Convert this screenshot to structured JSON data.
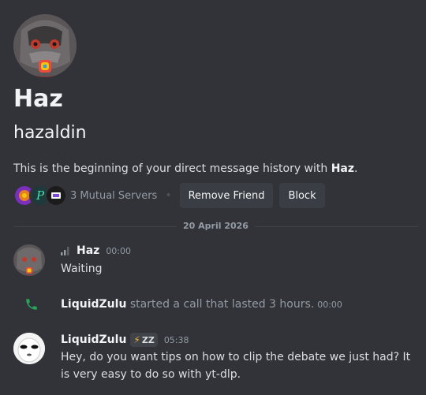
{
  "profile": {
    "display_name": "Haz",
    "username": "hazaldin",
    "intro_prefix": "This is the beginning of your direct message history with ",
    "intro_name": "Haz",
    "intro_suffix": ".",
    "mutual_servers": "3 Mutual Servers",
    "separator": "•",
    "remove_friend_label": "Remove Friend",
    "block_label": "Block"
  },
  "date_divider": "20 April 2026",
  "messages": [
    {
      "author": "Haz",
      "time": "00:00",
      "text": "Waiting"
    }
  ],
  "system_message": {
    "author": "LiquidZulu",
    "text": " started a call that lasted 3 hours.",
    "time": "00:00"
  },
  "reply": {
    "author": "LiquidZulu",
    "tag_icon": "lightning-icon",
    "tag": "ZZ",
    "time": "05:38",
    "text": "Hey, do you want tips on how to clip the debate we just had? It is very easy to do so with yt-dlp."
  },
  "colors": {
    "background": "#313338",
    "button": "#3b3d44",
    "call_green": "#23a55a",
    "muted": "#949ba4"
  }
}
